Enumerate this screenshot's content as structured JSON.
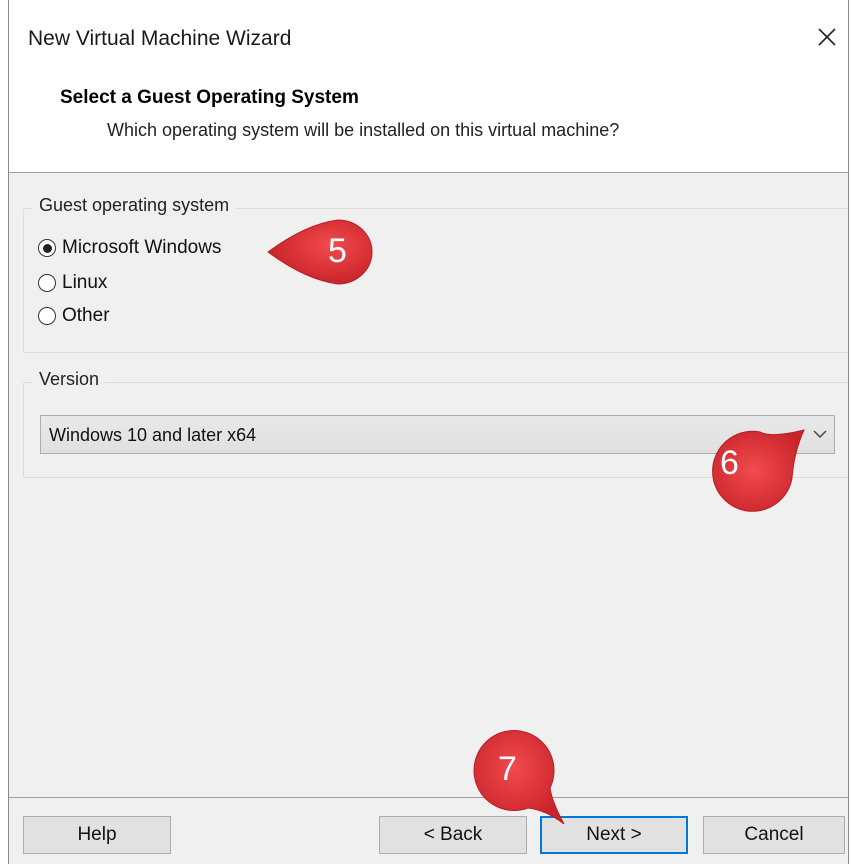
{
  "window": {
    "title": "New Virtual Machine Wizard",
    "close_icon": "close-icon"
  },
  "header": {
    "title": "Select a Guest Operating System",
    "subtitle": "Which operating system will be installed on this virtual machine?"
  },
  "guest_os": {
    "label": "Guest operating system",
    "options": [
      {
        "label": "Microsoft Windows",
        "selected": true
      },
      {
        "label": "Linux",
        "selected": false
      },
      {
        "label": "Other",
        "selected": false
      }
    ]
  },
  "version": {
    "label": "Version",
    "selected": "Windows 10 and later x64",
    "arrow_icon": "chevron-down-icon"
  },
  "buttons": {
    "help": "Help",
    "back": "< Back",
    "next": "Next >",
    "cancel": "Cancel"
  },
  "annotations": {
    "step5": "5",
    "step6": "6",
    "step7": "7",
    "color": "#e8353a"
  }
}
